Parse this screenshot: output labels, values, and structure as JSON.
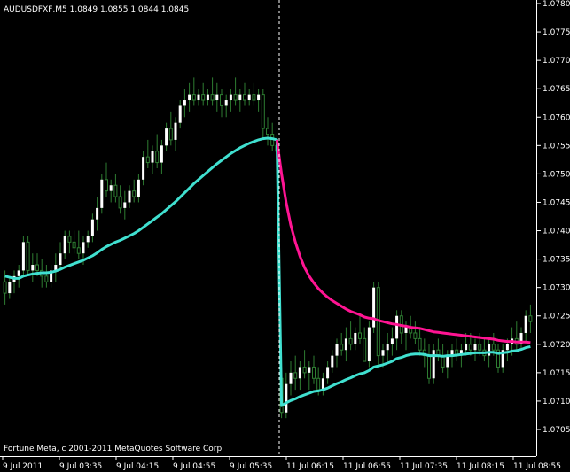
{
  "window": {
    "symbol_line": "AUDUSDFXF,M5  1.0849 1.0855 1.0844 1.0845",
    "copyright": "Fortune Meta, c 2001-2011 MetaQuotes Software Corp."
  },
  "colors": {
    "background": "#000000",
    "axis": "#ffffff",
    "bull_candle": "#ffffff",
    "bear_candle": "#000000",
    "wick": "#2e7d32",
    "ma_cyan": "#40e0d0",
    "ma_pink": "#ff1493",
    "separator": "#ffffff"
  },
  "chart_data": {
    "type": "candlestick",
    "title": "AUDUSDFXF,M5",
    "ylim": [
      1.0701,
      1.078
    ],
    "y_ticks": [
      "1.0780",
      "1.0775",
      "1.0770",
      "1.0765",
      "1.0760",
      "1.0755",
      "1.0750",
      "1.0745",
      "1.0740",
      "1.0735",
      "1.0730",
      "1.0725",
      "1.0720",
      "1.0715",
      "1.0710",
      "1.0705"
    ],
    "x_ticks": [
      "9 Jul 2011",
      "9 Jul 03:35",
      "9 Jul 04:15",
      "9 Jul 04:55",
      "9 Jul 05:35",
      "11 Jul 06:15",
      "11 Jul 06:55",
      "11 Jul 07:35",
      "11 Jul 08:15",
      "11 Jul 08:55"
    ],
    "grid": false,
    "separator_after_candle": 59,
    "candles": [
      [
        1.0731,
        1.0733,
        1.0727,
        1.0729
      ],
      [
        1.0729,
        1.0732,
        1.0728,
        1.0731
      ],
      [
        1.0731,
        1.0733,
        1.0729,
        1.0732
      ],
      [
        1.0732,
        1.0734,
        1.073,
        1.0733
      ],
      [
        1.0733,
        1.0739,
        1.0732,
        1.0738
      ],
      [
        1.0738,
        1.0739,
        1.0732,
        1.0733
      ],
      [
        1.0733,
        1.0736,
        1.0731,
        1.0734
      ],
      [
        1.0734,
        1.0736,
        1.0732,
        1.0733
      ],
      [
        1.0733,
        1.0735,
        1.073,
        1.0732
      ],
      [
        1.0732,
        1.0734,
        1.073,
        1.0731
      ],
      [
        1.0731,
        1.0734,
        1.073,
        1.0733
      ],
      [
        1.0733,
        1.0736,
        1.0731,
        1.0734
      ],
      [
        1.0734,
        1.0738,
        1.0733,
        1.0736
      ],
      [
        1.0736,
        1.074,
        1.0735,
        1.0739
      ],
      [
        1.0739,
        1.074,
        1.0736,
        1.0738
      ],
      [
        1.0738,
        1.074,
        1.0736,
        1.0737
      ],
      [
        1.0737,
        1.074,
        1.0735,
        1.0736
      ],
      [
        1.0736,
        1.0739,
        1.0734,
        1.0738
      ],
      [
        1.0738,
        1.074,
        1.0737,
        1.0739
      ],
      [
        1.0739,
        1.0743,
        1.0738,
        1.0742
      ],
      [
        1.0742,
        1.0746,
        1.074,
        1.0744
      ],
      [
        1.0744,
        1.075,
        1.0743,
        1.0749
      ],
      [
        1.0749,
        1.0752,
        1.0746,
        1.0747
      ],
      [
        1.0747,
        1.0749,
        1.0745,
        1.0748
      ],
      [
        1.0748,
        1.075,
        1.0745,
        1.0746
      ],
      [
        1.0746,
        1.0748,
        1.0743,
        1.0744
      ],
      [
        1.0744,
        1.0747,
        1.0742,
        1.0745
      ],
      [
        1.0745,
        1.0748,
        1.0744,
        1.0747
      ],
      [
        1.0747,
        1.0749,
        1.0745,
        1.0746
      ],
      [
        1.0746,
        1.075,
        1.0745,
        1.0749
      ],
      [
        1.0749,
        1.0754,
        1.0748,
        1.0753
      ],
      [
        1.0753,
        1.0756,
        1.0751,
        1.0752
      ],
      [
        1.0752,
        1.0755,
        1.075,
        1.0754
      ],
      [
        1.0754,
        1.0757,
        1.0751,
        1.0752
      ],
      [
        1.0752,
        1.0756,
        1.075,
        1.0755
      ],
      [
        1.0755,
        1.0759,
        1.0754,
        1.0758
      ],
      [
        1.0758,
        1.0761,
        1.0755,
        1.0756
      ],
      [
        1.0756,
        1.076,
        1.0754,
        1.0759
      ],
      [
        1.0759,
        1.0763,
        1.0758,
        1.0762
      ],
      [
        1.0762,
        1.0765,
        1.076,
        1.0763
      ],
      [
        1.0763,
        1.0766,
        1.0761,
        1.0764
      ],
      [
        1.0764,
        1.0767,
        1.0762,
        1.0763
      ],
      [
        1.0763,
        1.0765,
        1.0762,
        1.0764
      ],
      [
        1.0764,
        1.0766,
        1.0762,
        1.0763
      ],
      [
        1.0763,
        1.0765,
        1.0762,
        1.0764
      ],
      [
        1.0764,
        1.0767,
        1.0762,
        1.0763
      ],
      [
        1.0763,
        1.0766,
        1.0761,
        1.0764
      ],
      [
        1.0764,
        1.0765,
        1.076,
        1.0762
      ],
      [
        1.0762,
        1.0764,
        1.076,
        1.0763
      ],
      [
        1.0763,
        1.0765,
        1.0761,
        1.0764
      ],
      [
        1.0764,
        1.0767,
        1.0762,
        1.0763
      ],
      [
        1.0763,
        1.0765,
        1.0761,
        1.0764
      ],
      [
        1.0764,
        1.0766,
        1.0762,
        1.0763
      ],
      [
        1.0763,
        1.0765,
        1.0762,
        1.0764
      ],
      [
        1.0764,
        1.0766,
        1.0762,
        1.0763
      ],
      [
        1.0763,
        1.0765,
        1.0761,
        1.0764
      ],
      [
        1.0764,
        1.0765,
        1.0756,
        1.0758
      ],
      [
        1.0758,
        1.076,
        1.0755,
        1.0757
      ],
      [
        1.0757,
        1.0759,
        1.0754,
        1.0755
      ],
      [
        1.0755,
        1.0757,
        1.0752,
        1.0754
      ],
      [
        1.0714,
        1.0716,
        1.0707,
        1.0708
      ],
      [
        1.0708,
        1.0715,
        1.0707,
        1.0713
      ],
      [
        1.0713,
        1.0717,
        1.0711,
        1.0715
      ],
      [
        1.0715,
        1.0718,
        1.0712,
        1.0714
      ],
      [
        1.0714,
        1.0717,
        1.0712,
        1.0716
      ],
      [
        1.0716,
        1.0719,
        1.0714,
        1.0715
      ],
      [
        1.0715,
        1.0717,
        1.0712,
        1.0716
      ],
      [
        1.0716,
        1.0718,
        1.0713,
        1.0714
      ],
      [
        1.0714,
        1.0716,
        1.0711,
        1.0712
      ],
      [
        1.0712,
        1.0715,
        1.0711,
        1.0714
      ],
      [
        1.0714,
        1.0717,
        1.0713,
        1.0716
      ],
      [
        1.0716,
        1.0719,
        1.0715,
        1.0718
      ],
      [
        1.0718,
        1.0721,
        1.0716,
        1.072
      ],
      [
        1.072,
        1.0722,
        1.0718,
        1.0719
      ],
      [
        1.0719,
        1.0723,
        1.0717,
        1.0721
      ],
      [
        1.0721,
        1.0724,
        1.0719,
        1.072
      ],
      [
        1.072,
        1.0723,
        1.0719,
        1.0722
      ],
      [
        1.0722,
        1.0725,
        1.072,
        1.0721
      ],
      [
        1.0721,
        1.0723,
        1.0718,
        1.0717
      ],
      [
        1.0717,
        1.0724,
        1.0716,
        1.0723
      ],
      [
        1.0723,
        1.0731,
        1.0722,
        1.073
      ],
      [
        1.073,
        1.0731,
        1.0716,
        1.0718
      ],
      [
        1.0718,
        1.072,
        1.0716,
        1.0719
      ],
      [
        1.0719,
        1.0722,
        1.0717,
        1.072
      ],
      [
        1.072,
        1.0723,
        1.0718,
        1.0721
      ],
      [
        1.0721,
        1.0726,
        1.0719,
        1.0725
      ],
      [
        1.0725,
        1.0726,
        1.072,
        1.0722
      ],
      [
        1.0722,
        1.0724,
        1.0719,
        1.0723
      ],
      [
        1.0723,
        1.0725,
        1.0721,
        1.0722
      ],
      [
        1.0722,
        1.0724,
        1.072,
        1.0721
      ],
      [
        1.0721,
        1.0723,
        1.0718,
        1.0719
      ],
      [
        1.0719,
        1.0721,
        1.0716,
        1.0718
      ],
      [
        1.0718,
        1.072,
        1.0713,
        1.0714
      ],
      [
        1.0714,
        1.072,
        1.0713,
        1.0719
      ],
      [
        1.0719,
        1.0721,
        1.0717,
        1.0718
      ],
      [
        1.0718,
        1.072,
        1.0715,
        1.0716
      ],
      [
        1.0716,
        1.0719,
        1.0714,
        1.0718
      ],
      [
        1.0718,
        1.072,
        1.0716,
        1.0719
      ],
      [
        1.0719,
        1.0721,
        1.0717,
        1.0718
      ],
      [
        1.0718,
        1.072,
        1.0716,
        1.0719
      ],
      [
        1.0719,
        1.0722,
        1.0718,
        1.072
      ],
      [
        1.072,
        1.0722,
        1.0718,
        1.0719
      ],
      [
        1.0719,
        1.0721,
        1.0717,
        1.072
      ],
      [
        1.072,
        1.0722,
        1.0718,
        1.0719
      ],
      [
        1.0719,
        1.0721,
        1.0717,
        1.0718
      ],
      [
        1.0718,
        1.0721,
        1.0716,
        1.072
      ],
      [
        1.072,
        1.0722,
        1.0718,
        1.0719
      ],
      [
        1.0719,
        1.072,
        1.0715,
        1.0716
      ],
      [
        1.0716,
        1.072,
        1.0715,
        1.0719
      ],
      [
        1.0719,
        1.0721,
        1.0717,
        1.072
      ],
      [
        1.072,
        1.0723,
        1.0718,
        1.0721
      ],
      [
        1.0721,
        1.0724,
        1.0719,
        1.072
      ],
      [
        1.072,
        1.0723,
        1.0719,
        1.0722
      ],
      [
        1.0722,
        1.0726,
        1.072,
        1.0725
      ],
      [
        1.0725,
        1.0727,
        1.0722,
        1.0724
      ]
    ],
    "series": [
      {
        "color": "#40e0d0",
        "values": [
          1.0732,
          1.07318,
          1.07316,
          1.07316,
          1.0732,
          1.07322,
          1.07324,
          1.07325,
          1.07326,
          1.07326,
          1.07327,
          1.07329,
          1.07332,
          1.07336,
          1.07339,
          1.07342,
          1.07345,
          1.07348,
          1.07352,
          1.07356,
          1.07361,
          1.07367,
          1.07372,
          1.07376,
          1.0738,
          1.07383,
          1.07387,
          1.07391,
          1.07395,
          1.074,
          1.07406,
          1.07412,
          1.07418,
          1.07424,
          1.0743,
          1.07437,
          1.07444,
          1.07451,
          1.07459,
          1.07467,
          1.07475,
          1.07483,
          1.0749,
          1.07497,
          1.07504,
          1.07511,
          1.07518,
          1.07524,
          1.0753,
          1.07536,
          1.07541,
          1.07546,
          1.0755,
          1.07554,
          1.07557,
          1.0756,
          1.07562,
          1.07563,
          1.07562,
          1.0756,
          1.07092,
          1.07097,
          1.07101,
          1.07104,
          1.07108,
          1.07111,
          1.07114,
          1.07117,
          1.07118,
          1.0712,
          1.07123,
          1.07127,
          1.07131,
          1.07134,
          1.07138,
          1.07141,
          1.07145,
          1.07148,
          1.0715,
          1.07154,
          1.0716,
          1.07162,
          1.07164,
          1.07167,
          1.0717,
          1.07175,
          1.07177,
          1.0718,
          1.07182,
          1.07183,
          1.07183,
          1.07182,
          1.0718,
          1.0718,
          1.0718,
          1.07179,
          1.0718,
          1.0718,
          1.07181,
          1.07182,
          1.07183,
          1.07184,
          1.07185,
          1.07185,
          1.07185,
          1.07186,
          1.07186,
          1.07184,
          1.07185,
          1.07186,
          1.07188,
          1.07189,
          1.07191,
          1.07194,
          1.07196
        ]
      },
      {
        "color": "#ff1493",
        "values": [
          null,
          null,
          null,
          null,
          null,
          null,
          null,
          null,
          null,
          null,
          null,
          null,
          null,
          null,
          null,
          null,
          null,
          null,
          null,
          null,
          null,
          null,
          null,
          null,
          null,
          null,
          null,
          null,
          null,
          null,
          null,
          null,
          null,
          null,
          null,
          null,
          null,
          null,
          null,
          null,
          null,
          null,
          null,
          null,
          null,
          null,
          null,
          null,
          null,
          null,
          null,
          null,
          null,
          null,
          null,
          null,
          null,
          null,
          null,
          1.0756,
          1.075,
          1.0745,
          1.0741,
          1.0738,
          1.07355,
          1.07335,
          1.0732,
          1.07308,
          1.07298,
          1.0729,
          1.07283,
          1.07277,
          1.07272,
          1.07267,
          1.07262,
          1.07258,
          1.07255,
          1.07252,
          1.07248,
          1.07246,
          1.07245,
          1.07242,
          1.0724,
          1.07238,
          1.07236,
          1.07235,
          1.07233,
          1.07232,
          1.0723,
          1.07229,
          1.07228,
          1.07226,
          1.07224,
          1.07222,
          1.07221,
          1.0722,
          1.07219,
          1.07218,
          1.07217,
          1.07216,
          1.07215,
          1.07214,
          1.07213,
          1.07212,
          1.07211,
          1.0721,
          1.07209,
          1.07207,
          1.07206,
          1.07205,
          1.07205,
          1.07204,
          1.07204,
          1.07204,
          1.07203
        ]
      }
    ]
  }
}
